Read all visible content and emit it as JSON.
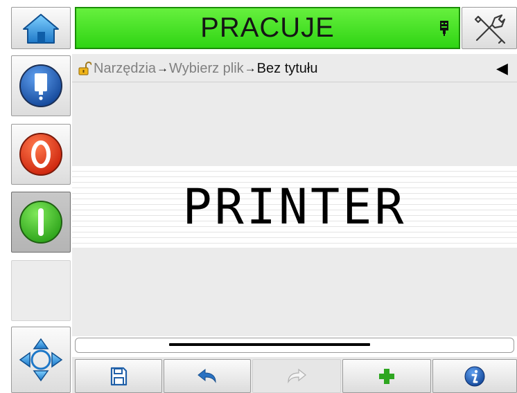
{
  "status": {
    "label": "PRACUJE",
    "color": "#3ee01f"
  },
  "breadcrumb": {
    "lock_icon": "padlock-icon",
    "items": [
      {
        "label": "Narzędzia"
      },
      {
        "label": "Wybierz plik"
      },
      {
        "label": "Bez tytułu"
      }
    ],
    "separator": "→",
    "collapse_arrow": "◀"
  },
  "message": {
    "text": "PRINTER"
  },
  "left_toolbar": [
    {
      "icon": "home-icon"
    },
    {
      "icon": "ink-cartridge-icon"
    },
    {
      "icon": "stop-icon",
      "color": "#e02a10"
    },
    {
      "icon": "start-icon",
      "color": "#2fbd1a"
    },
    {
      "icon": "navigation-arrows-icon"
    }
  ],
  "top_right": {
    "icon": "tools-icon"
  },
  "bottom_toolbar": [
    {
      "icon": "save-icon"
    },
    {
      "icon": "undo-icon"
    },
    {
      "icon": "redo-icon",
      "enabled": false
    },
    {
      "icon": "add-icon"
    },
    {
      "icon": "info-icon"
    }
  ]
}
